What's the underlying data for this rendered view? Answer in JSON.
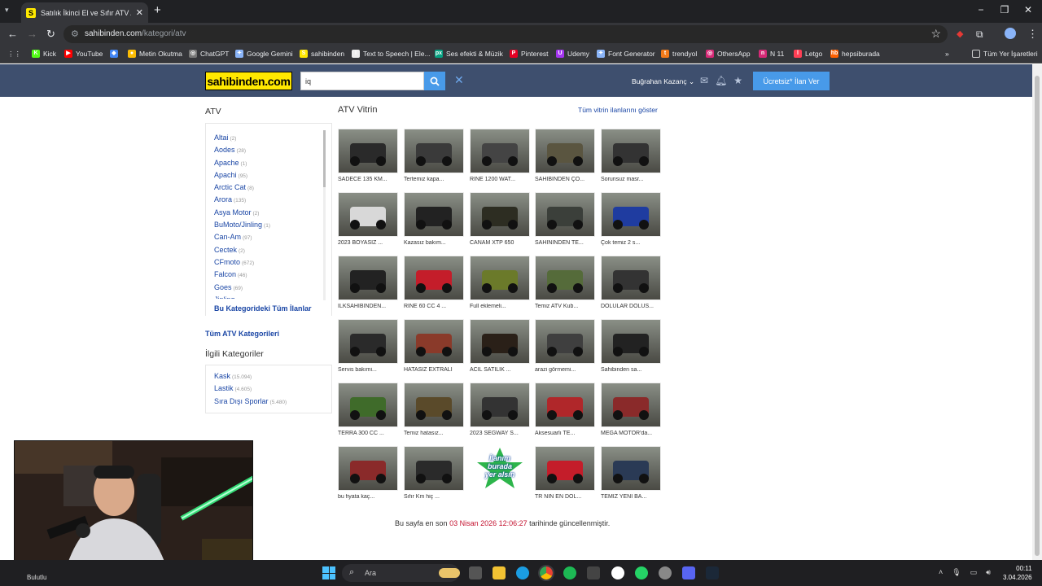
{
  "browser": {
    "tab_title": "Satılık İkinci El ve Sıfır ATV A",
    "tab_favicon": "S",
    "url_host": "sahibinden.com",
    "url_path": "/kategori/atv",
    "bookmarks": [
      {
        "label": "Kick",
        "icon": "K",
        "color": "#53fc18"
      },
      {
        "label": "YouTube",
        "icon": "▶",
        "color": "#ff0000"
      },
      {
        "label": "",
        "icon": "◆",
        "color": "#4285f4"
      },
      {
        "label": "Metin Okutma",
        "icon": "●",
        "color": "#fbbc04"
      },
      {
        "label": "ChatGPT",
        "icon": "◎",
        "color": "#777"
      },
      {
        "label": "Google Gemini",
        "icon": "✦",
        "color": "#8ab4f8"
      },
      {
        "label": "sahibinden",
        "icon": "S",
        "color": "#ffe800"
      },
      {
        "label": "Text to Speech | Ele...",
        "icon": "I",
        "color": "#eee"
      },
      {
        "label": "Ses efekti & Müzik",
        "icon": "px",
        "color": "#05a081"
      },
      {
        "label": "Pinterest",
        "icon": "P",
        "color": "#e60023"
      },
      {
        "label": "Udemy",
        "icon": "U",
        "color": "#a435f0"
      },
      {
        "label": "Font Generator",
        "icon": "✦",
        "color": "#8ab4f8"
      },
      {
        "label": "trendyol",
        "icon": "t",
        "color": "#f27a1a"
      },
      {
        "label": "OthersApp",
        "icon": "◎",
        "color": "#d62976"
      },
      {
        "label": "N 11",
        "icon": "n",
        "color": "#d62976"
      },
      {
        "label": "Letgo",
        "icon": "l",
        "color": "#ff3f55"
      },
      {
        "label": "hepsiburada",
        "icon": "hb",
        "color": "#ff6000"
      }
    ],
    "all_bookmarks": "Tüm Yer İşaretleri"
  },
  "header": {
    "logo": "sahibinden.com",
    "search_value": "iq",
    "user_name": "Buğrahan Kazanç",
    "post_button": "Ücretsiz* İlan Ver"
  },
  "sidebar": {
    "title": "ATV",
    "categories": [
      {
        "name": "Altai",
        "count": "(2)"
      },
      {
        "name": "Aodes",
        "count": "(28)"
      },
      {
        "name": "Apache",
        "count": "(1)"
      },
      {
        "name": "Apachi",
        "count": "(95)"
      },
      {
        "name": "Arctic Cat",
        "count": "(8)"
      },
      {
        "name": "Arora",
        "count": "(135)"
      },
      {
        "name": "Asya Motor",
        "count": "(2)"
      },
      {
        "name": "BuMoto/Jinling",
        "count": "(1)"
      },
      {
        "name": "Can-Am",
        "count": "(97)"
      },
      {
        "name": "Cectek",
        "count": "(2)"
      },
      {
        "name": "CFmoto",
        "count": "(672)"
      },
      {
        "name": "Falcon",
        "count": "(46)"
      },
      {
        "name": "Goes",
        "count": "(69)"
      },
      {
        "name": "Jinling",
        "count": ""
      }
    ],
    "all_in_category": "Bu Kategorideki Tüm İlanlar",
    "all_atv_categories": "Tüm ATV Kategorileri",
    "related_title": "İlgili Kategoriler",
    "related": [
      {
        "name": "Kask",
        "count": "(15.094)"
      },
      {
        "name": "Lastik",
        "count": "(4.605)"
      },
      {
        "name": "Sıra Dışı Sporlar",
        "count": "(5.480)"
      }
    ]
  },
  "vitrin": {
    "title": "ATV Vitrin",
    "show_all": "Tüm vitrin ilanlarını göster",
    "items": [
      {
        "label": "SADECE 135 KM...",
        "color": "#2a2a2a"
      },
      {
        "label": "Tertemiz kapa...",
        "color": "#3a3a3a"
      },
      {
        "label": "RINE 1200 WAT...",
        "color": "#444444"
      },
      {
        "label": "SAHİBİNDEN ÇO...",
        "color": "#5a5540"
      },
      {
        "label": "Sorunsuz masr...",
        "color": "#333333"
      },
      {
        "label": "2023 BOYASIZ ...",
        "color": "#d8d8d8"
      },
      {
        "label": "Kazasız bakım...",
        "color": "#222222"
      },
      {
        "label": "CANAM XTP 650",
        "color": "#2d2d22"
      },
      {
        "label": "SAHİNİNDEN TE...",
        "color": "#3b3f3a"
      },
      {
        "label": "Çok temiz 2 s...",
        "color": "#1f3ca0"
      },
      {
        "label": "İLKSAHİBİNDEN...",
        "color": "#222222"
      },
      {
        "label": "RINE 60 CC 4 ...",
        "color": "#c41d2a"
      },
      {
        "label": "Full eklemeli...",
        "color": "#6b7a2a"
      },
      {
        "label": "Temiz ATV Kub...",
        "color": "#556b3a"
      },
      {
        "label": "DOLULAR DOLUS...",
        "color": "#333333"
      },
      {
        "label": "Servis bakımi...",
        "color": "#2a2a2a"
      },
      {
        "label": "HATASIZ EXTRALI",
        "color": "#8a3a2a"
      },
      {
        "label": "ACİL SATILIK ...",
        "color": "#2a2018"
      },
      {
        "label": "arazi görmemi...",
        "color": "#3f3f3f"
      },
      {
        "label": "Sahibinden sa...",
        "color": "#222222"
      },
      {
        "label": "TERRA 300 CC ...",
        "color": "#3f6b2a"
      },
      {
        "label": "Temiz hatasız...",
        "color": "#5a4a2a"
      },
      {
        "label": "2023 SEGWAY S...",
        "color": "#333333"
      },
      {
        "label": "Aksesuarlı TE...",
        "color": "#b0272a"
      },
      {
        "label": "MEGA MOTOR'da...",
        "color": "#8a2a2a"
      },
      {
        "label": "bu fiyata kaç...",
        "color": "#8a2a2a"
      },
      {
        "label": "Sıfır Km hiç ...",
        "color": "#2a2a2a"
      },
      {
        "label": "",
        "color": "promo"
      },
      {
        "label": "TR NİN EN DOL...",
        "color": "#c41d2a"
      },
      {
        "label": "TEMİZ YENİ BA...",
        "color": "#2a3a55"
      }
    ],
    "promo_lines": [
      "İlanım",
      "burada",
      "yer alsın"
    ]
  },
  "footer": {
    "prefix": "Bu sayfa en son",
    "date": "03 Nisan 2026 12:06:27",
    "suffix": "tarihinde güncellenmiştir."
  },
  "taskbar": {
    "weather": "Bulutlu",
    "search": "Ara",
    "time": "00:11",
    "date": "3.04.2026"
  }
}
